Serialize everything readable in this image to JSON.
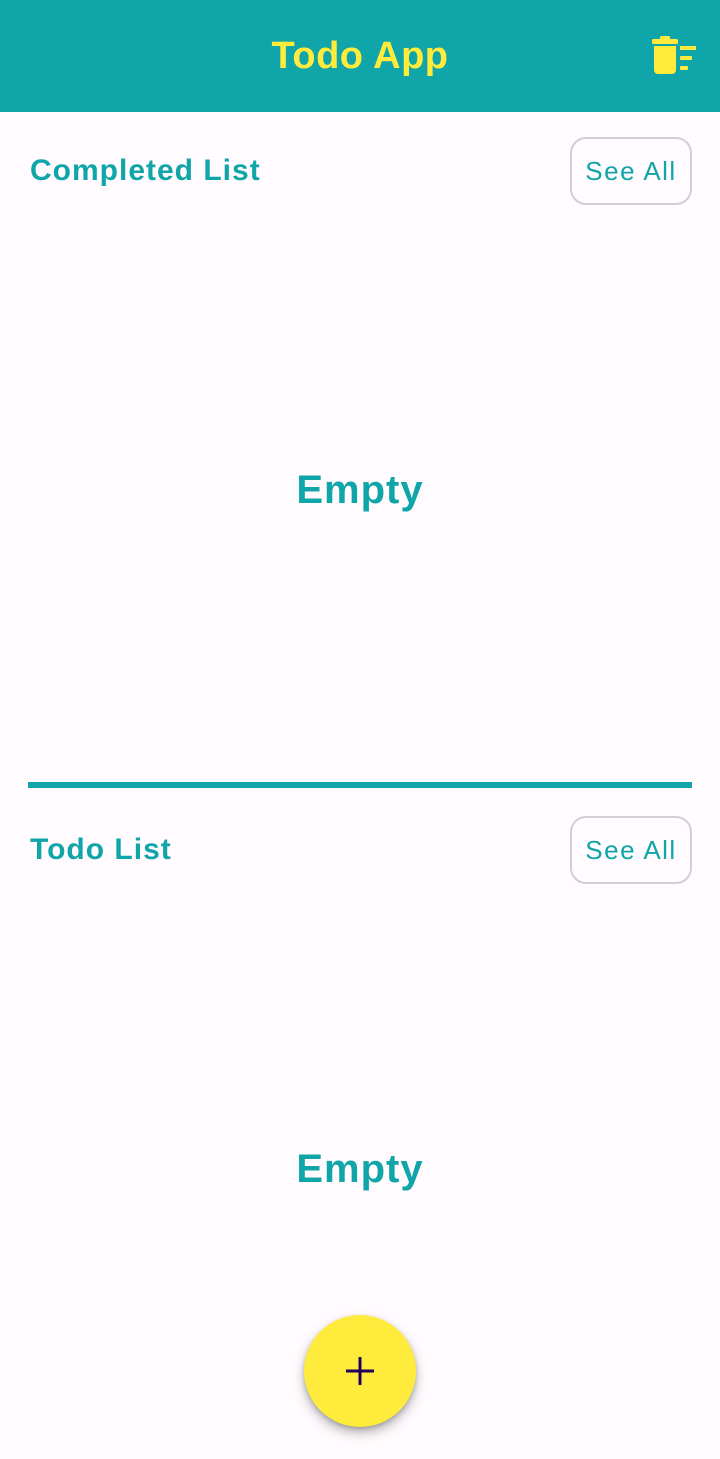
{
  "app_bar": {
    "title": "Todo App",
    "clear_icon": "delete-sweep-icon",
    "background_color": "#10a5a8",
    "title_color": "#ffeb3b"
  },
  "completed_section": {
    "title": "Completed List",
    "see_all_label": "See All",
    "empty_text": "Empty"
  },
  "todo_section": {
    "title": "Todo List",
    "see_all_label": "See All",
    "empty_text": "Empty"
  },
  "fab": {
    "icon": "plus-icon",
    "color": "#ffeb3b"
  },
  "colors": {
    "accent": "#10a5a8",
    "background": "#fffbfe",
    "highlight": "#ffeb3b"
  }
}
